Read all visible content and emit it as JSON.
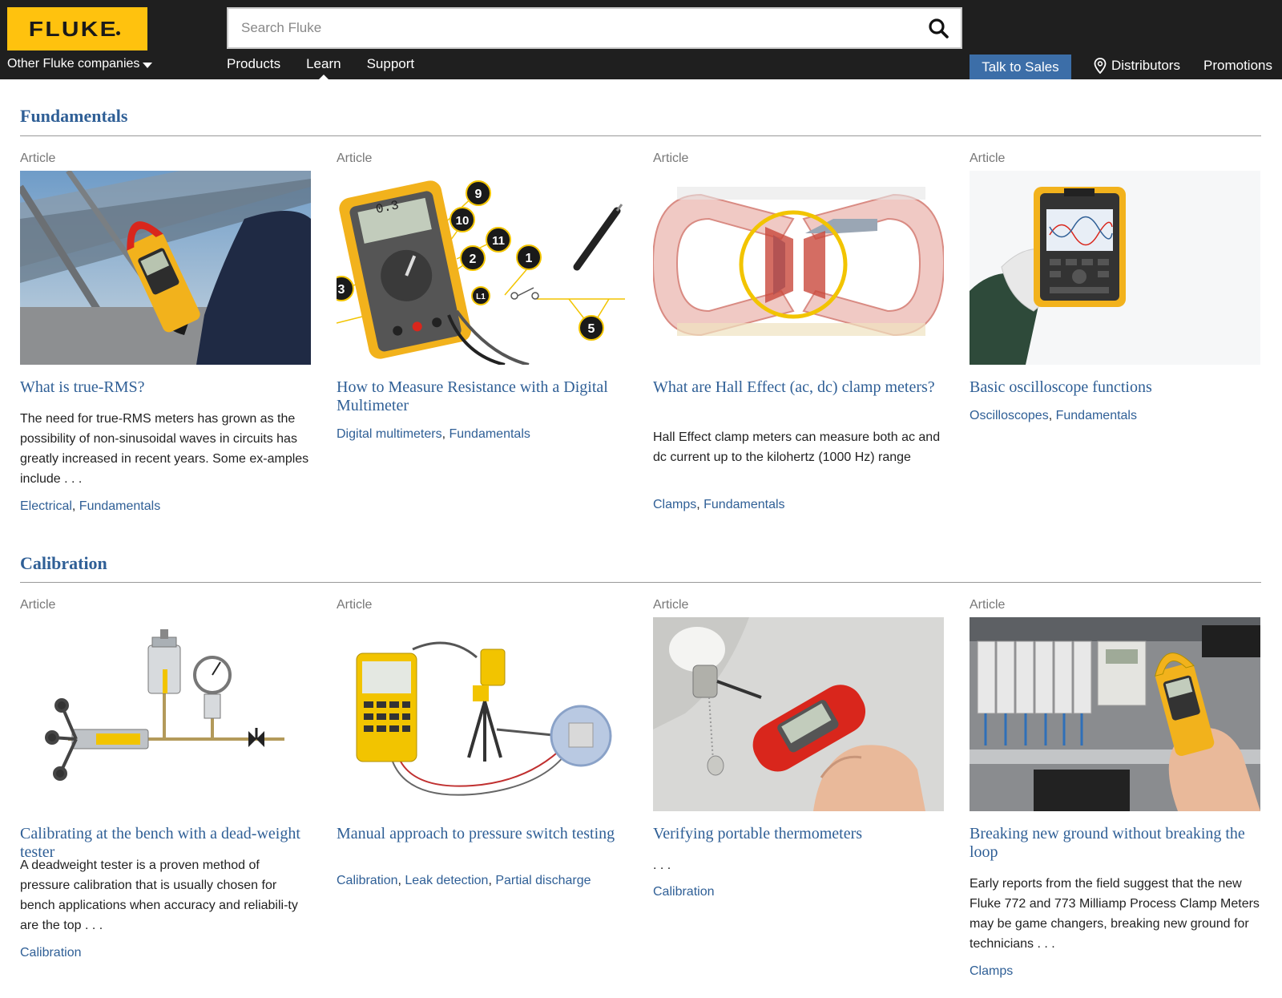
{
  "header": {
    "logo_text": "FLUKE",
    "other_companies": "Other Fluke companies",
    "search_placeholder": "Search Fluke",
    "nav": [
      "Products",
      "Learn",
      "Support"
    ],
    "active_nav": "Learn",
    "talk_to_sales": "Talk to Sales",
    "distributors": "Distributors",
    "promotions": "Promotions"
  },
  "sections": [
    {
      "title": "Fundamentals",
      "cards": [
        {
          "type": "Article",
          "title": "What is true-RMS?",
          "description": "The need for true-RMS meters has grown as the possibility of non-sinusoidal waves in circuits has greatly increased in recent years. Some ex-amples include . . .",
          "tags": [
            "Electrical",
            "Fundamentals"
          ],
          "image": "clamp-meter-solar-photo"
        },
        {
          "type": "Article",
          "title": "How to Measure Resistance with a Digital Multimeter",
          "description": "",
          "tags": [
            "Digital multimeters",
            "Fundamentals"
          ],
          "image": "multimeter-diagram",
          "image_labels": [
            "9",
            "10",
            "11",
            "2",
            "1",
            "3",
            "L1",
            "5"
          ],
          "display_reading": "0.3"
        },
        {
          "type": "Article",
          "title": "What are Hall Effect (ac, dc) clamp meters?",
          "description": "Hall Effect clamp meters can measure both ac and dc current up to the kilohertz (1000 Hz) range",
          "tags": [
            "Clamps",
            "Fundamentals"
          ],
          "image": "hall-effect-jaws-diagram"
        },
        {
          "type": "Article",
          "title": "Basic oscilloscope functions",
          "description": "",
          "tags": [
            "Oscilloscopes",
            "Fundamentals"
          ],
          "image": "oscilloscope-in-hand-photo"
        }
      ]
    },
    {
      "title": "Calibration",
      "cards": [
        {
          "type": "Article",
          "title": "Calibrating at the bench with a dead-weight tester",
          "description": "A deadweight tester is a proven method of pressure calibration that is usually chosen for bench applications when accuracy and reliabili-ty are the top . . .",
          "tags": [
            "Calibration"
          ],
          "image": "deadweight-tester-diagram"
        },
        {
          "type": "Article",
          "title": "Manual approach to pressure switch testing",
          "description": "",
          "tags": [
            "Calibration",
            "Leak detection",
            "Partial discharge"
          ],
          "image": "pressure-switch-setup-diagram"
        },
        {
          "type": "Article",
          "title": "Verifying portable thermometers",
          "description": ". . .",
          "tags": [
            "Calibration"
          ],
          "image": "thermometer-probe-photo"
        },
        {
          "type": "Article",
          "title": "Breaking new ground without breaking the loop",
          "description": "Early reports from the field suggest that the new Fluke 772 and 773 Milliamp Process Clamp Meters may be game changers, breaking new ground for technicians . . .",
          "tags": [
            "Clamps"
          ],
          "image": "milliamp-clamp-panel-photo"
        }
      ]
    }
  ],
  "colors": {
    "header_bg": "#1f1f1f",
    "logo_yellow": "#ffc20e",
    "link_blue": "#2f5f96",
    "sales_button": "#3c6ea8"
  }
}
